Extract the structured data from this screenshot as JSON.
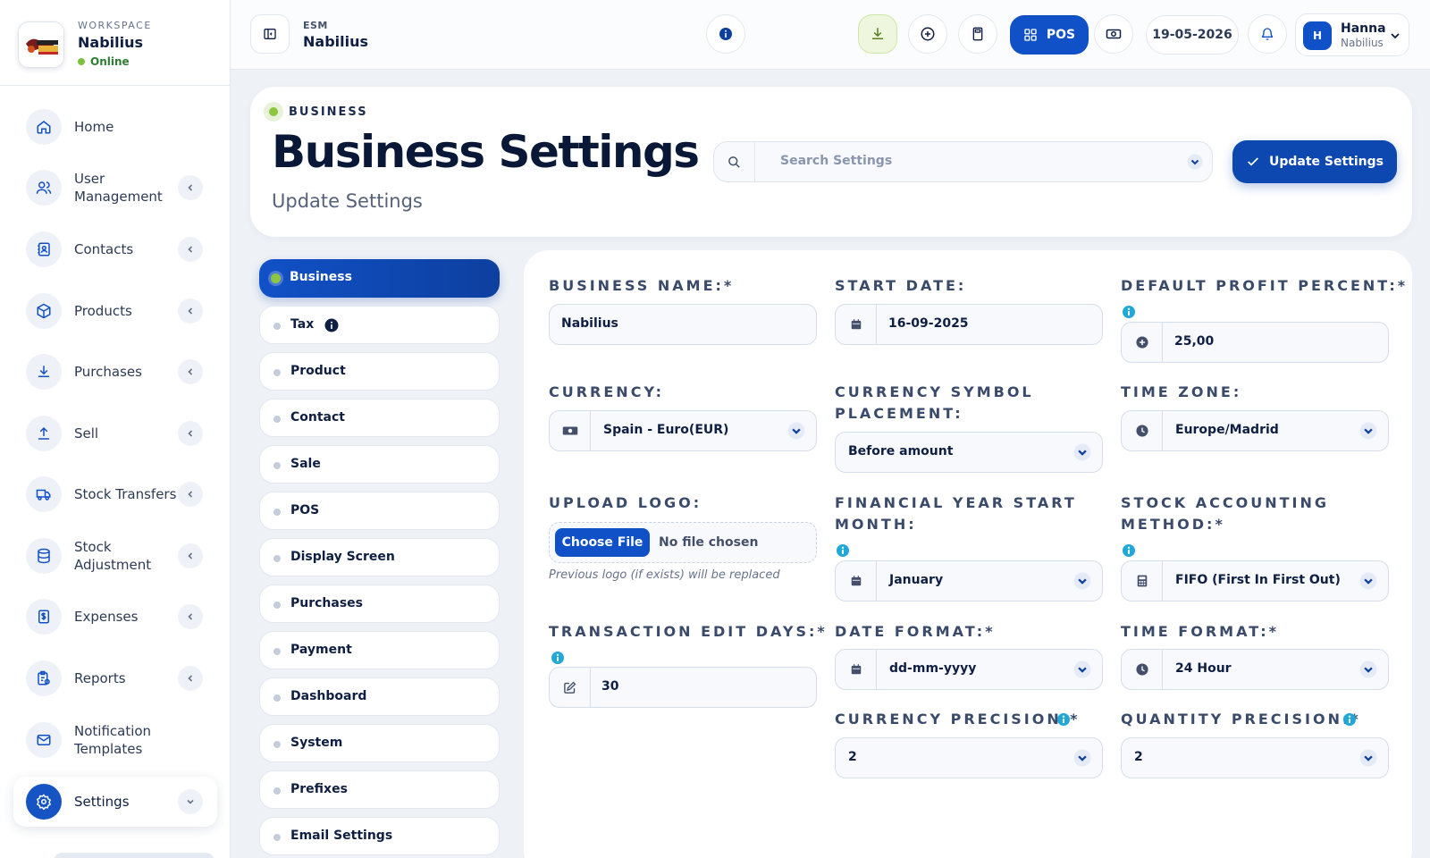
{
  "sidebar": {
    "workspace_small": "WORKSPACE",
    "workspace_name": "Nabilius",
    "status": "Online",
    "items": [
      {
        "label": "Home"
      },
      {
        "label": "User Management"
      },
      {
        "label": "Contacts"
      },
      {
        "label": "Products"
      },
      {
        "label": "Purchases"
      },
      {
        "label": "Sell"
      },
      {
        "label": "Stock Transfers"
      },
      {
        "label": "Stock Adjustment"
      },
      {
        "label": "Expenses"
      },
      {
        "label": "Reports"
      },
      {
        "label": "Notification Templates"
      },
      {
        "label": "Settings"
      }
    ]
  },
  "topbar": {
    "app_small": "ESM",
    "app_name": "Nabilius",
    "pos_label": "POS",
    "date": "19-05-2026",
    "user_initial": "H",
    "user_name": "Hanna",
    "user_sub": "Nabilius"
  },
  "header": {
    "breadcrumb": "BUSINESS",
    "title": "Business Settings",
    "subtitle": "Update Settings",
    "search_placeholder": "Search Settings",
    "update_button": "Update Settings"
  },
  "settings_menu": [
    {
      "label": "Business"
    },
    {
      "label": "Tax"
    },
    {
      "label": "Product"
    },
    {
      "label": "Contact"
    },
    {
      "label": "Sale"
    },
    {
      "label": "POS"
    },
    {
      "label": "Display Screen"
    },
    {
      "label": "Purchases"
    },
    {
      "label": "Payment"
    },
    {
      "label": "Dashboard"
    },
    {
      "label": "System"
    },
    {
      "label": "Prefixes"
    },
    {
      "label": "Email Settings"
    }
  ],
  "form": {
    "business_name": {
      "label": "BUSINESS NAME:*",
      "value": "Nabilius"
    },
    "start_date": {
      "label": "START DATE:",
      "value": "16-09-2025"
    },
    "default_profit": {
      "label": "DEFAULT PROFIT PERCENT:*",
      "value": "25,00"
    },
    "currency": {
      "label": "CURRENCY:",
      "value": "Spain - Euro(EUR)"
    },
    "currency_symbol": {
      "label_1": "CURRENCY SYMBOL",
      "label_2": "PLACEMENT:",
      "value": "Before amount"
    },
    "time_zone": {
      "label": "TIME ZONE:",
      "value": "Europe/Madrid"
    },
    "upload_logo": {
      "label": "UPLOAD LOGO:",
      "button": "Choose File",
      "status": "No file chosen",
      "hint": "Previous logo (if exists) will be replaced"
    },
    "fy_start": {
      "label_1": "FINANCIAL YEAR START",
      "label_2": "MONTH:",
      "value": "January"
    },
    "stock_method": {
      "label_1": "STOCK ACCOUNTING",
      "label_2": "METHOD:*",
      "value": "FIFO (First In First Out)"
    },
    "transaction_edit": {
      "label": "TRANSACTION EDIT DAYS:*",
      "value": "30"
    },
    "date_format": {
      "label": "DATE FORMAT:*",
      "value": "dd-mm-yyyy"
    },
    "time_format": {
      "label": "TIME FORMAT:*",
      "value": "24 Hour"
    },
    "currency_precision": {
      "label": "CURRENCY PRECISION:*",
      "value": "2"
    },
    "quantity_precision": {
      "label": "QUANTITY PRECISION:*",
      "value": "2"
    }
  },
  "colors": {
    "primary": "#1151c7",
    "accent_green": "#8cc63f",
    "info": "#1fa8d8"
  }
}
